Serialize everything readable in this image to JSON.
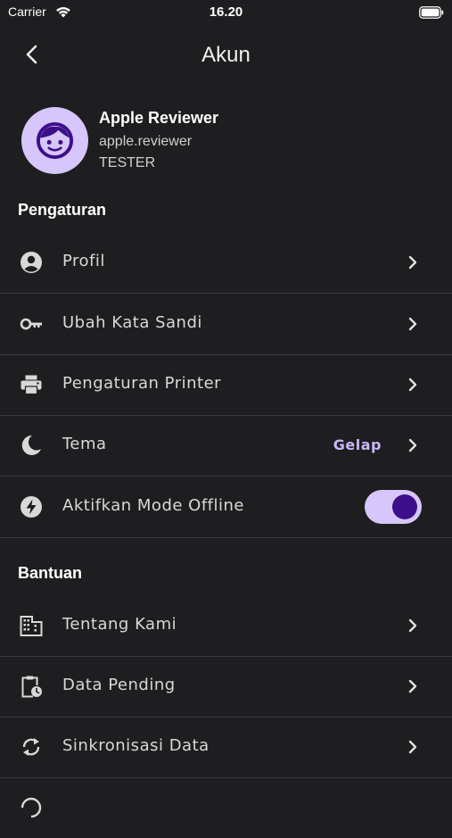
{
  "status_bar": {
    "carrier": "Carrier",
    "time": "16.20"
  },
  "nav": {
    "title": "Akun"
  },
  "profile": {
    "name": "Apple Reviewer",
    "username": "apple.reviewer",
    "role": "TESTER"
  },
  "sections": {
    "settings": {
      "title": "Pengaturan",
      "items": [
        {
          "label": "Profil",
          "icon": "account-circle-icon"
        },
        {
          "label": "Ubah Kata Sandi",
          "icon": "key-icon"
        },
        {
          "label": "Pengaturan Printer",
          "icon": "printer-icon"
        },
        {
          "label": "Tema",
          "icon": "moon-icon",
          "value": "Gelap"
        },
        {
          "label": "Aktifkan Mode Offline",
          "icon": "bolt-icon",
          "toggle": true
        }
      ]
    },
    "help": {
      "title": "Bantuan",
      "items": [
        {
          "label": "Tentang Kami",
          "icon": "building-icon"
        },
        {
          "label": "Data Pending",
          "icon": "clipboard-clock-icon"
        },
        {
          "label": "Sinkronisasi Data",
          "icon": "sync-icon"
        }
      ]
    }
  },
  "colors": {
    "background": "#1e1e20",
    "accent": "#d6c6fb",
    "accent_dark": "#3d0e8a",
    "value_text": "#c9b6f7",
    "divider": "#3a3a3e"
  }
}
